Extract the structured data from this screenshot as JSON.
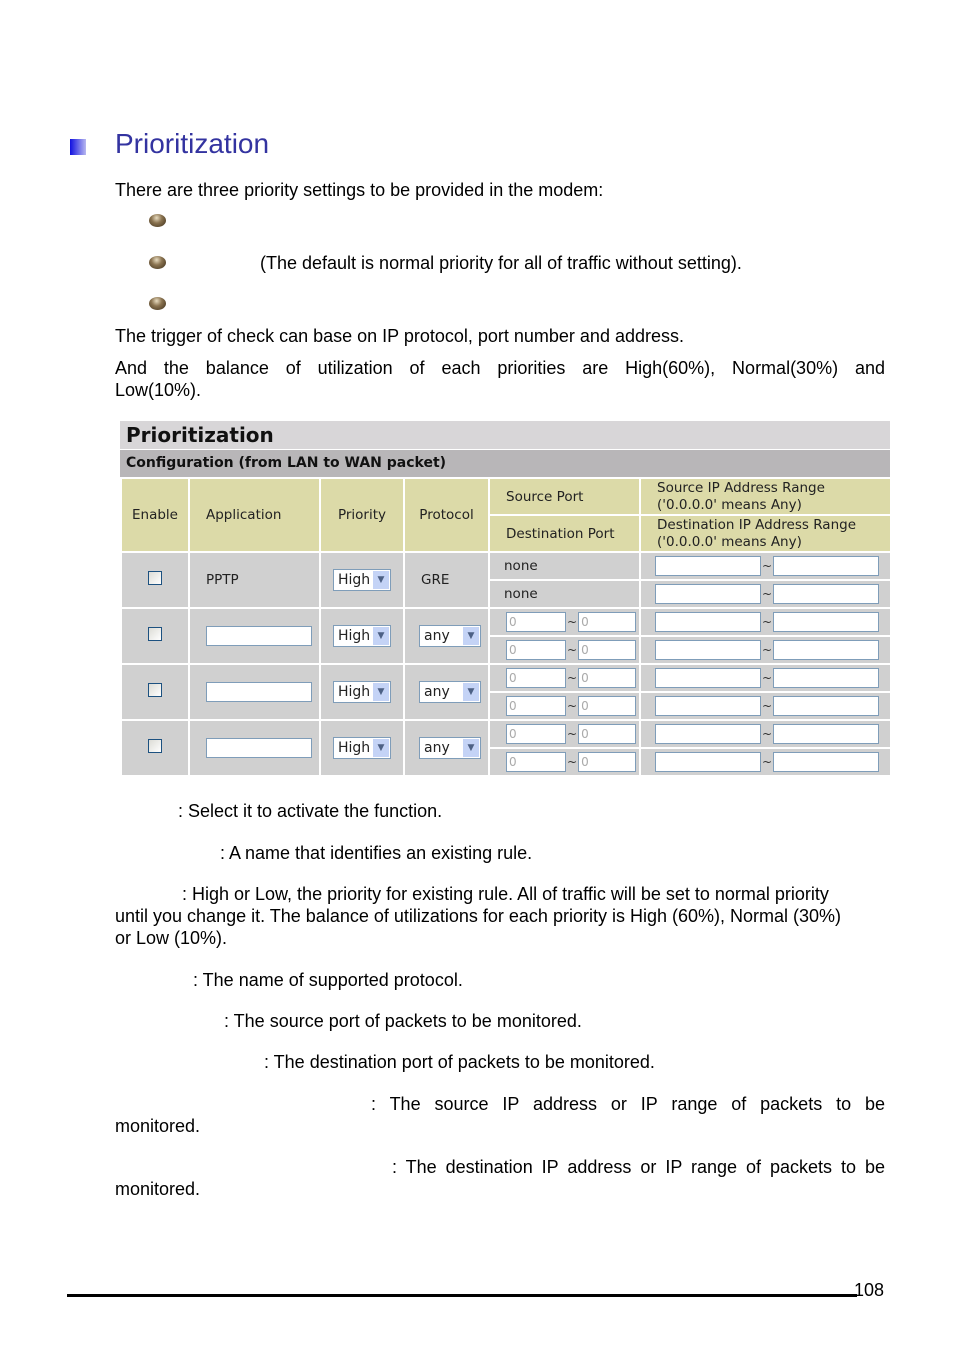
{
  "heading": "Prioritization",
  "intro": "There are three priority settings to be provided in the modem:",
  "bullets": [
    "",
    "(The default is normal priority for all of traffic without setting).",
    ""
  ],
  "p1": "The trigger of check can base on IP protocol, port number and address.",
  "p2a": "And the balance of utilization of each priorities are High(60%), Normal(30%) and",
  "p2b": "Low(10%).",
  "ui": {
    "title": "Prioritization",
    "config": "Configuration (from LAN to WAN packet)",
    "headers": {
      "enable": "Enable",
      "application": "Application",
      "priority": "Priority",
      "protocol": "Protocol",
      "source_port": "Source Port",
      "destination_port": "Destination Port",
      "source_ip": "Source IP Address Range",
      "source_ip_note": "('0.0.0.0' means Any)",
      "dest_ip": "Destination IP Address Range",
      "dest_ip_note": "('0.0.0.0' means Any)"
    },
    "row1": {
      "application": "PPTP",
      "priority": "High",
      "protocol": "GRE",
      "source_port": "none",
      "destination_port": "none"
    },
    "rows": [
      {
        "priority": "High",
        "protocol": "any",
        "port_value": "0"
      },
      {
        "priority": "High",
        "protocol": "any",
        "port_value": "0"
      },
      {
        "priority": "High",
        "protocol": "any",
        "port_value": "0"
      }
    ],
    "tilde": "~"
  },
  "desc": {
    "enable": ": Select it to activate the function.",
    "application": ": A name that identifies an existing rule.",
    "priority1": ": High or Low, the priority for existing rule. All of traffic will be set to normal priority",
    "priority2": "until you change it. The balance of utilizations for each priority is High (60%), Normal (30%)",
    "priority3": "or Low (10%).",
    "protocol": ": The name of supported protocol.",
    "source_port": ": The source port of packets to be monitored.",
    "dest_port": ": The destination port of packets to be monitored.",
    "source_ip": ": The source IP address or IP range of packets to be",
    "source_ip2": "monitored.",
    "dest_ip": ": The destination IP address or IP range of packets to be",
    "dest_ip2": "monitored."
  },
  "page_number": "108"
}
